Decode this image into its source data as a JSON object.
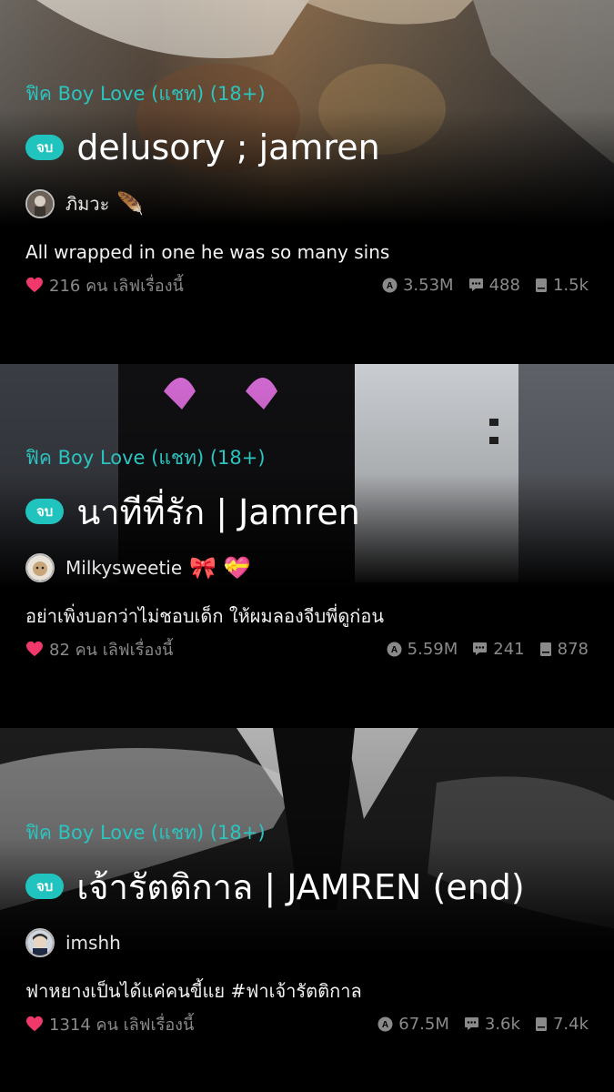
{
  "stories": [
    {
      "category": "ฟิค Boy Love (แชท) (18+)",
      "status_badge": "จบ",
      "title": "delusory ; jamren",
      "author": "ภิมวะ",
      "author_emoji": "🪶",
      "description": "All wrapped in one he was so many sins",
      "likes": "216 คน เลิฟเรื่องนี้",
      "views": "3.53M",
      "comments": "488",
      "chapters": "1.5k"
    },
    {
      "category": "ฟิค Boy Love (แชท) (18+)",
      "status_badge": "จบ",
      "title": "นาทีที่รัก | Jamren",
      "author": "Milkysweetie",
      "author_emoji": "🎀 💝",
      "description": "อย่าเพิ่งบอกว่าไม่ชอบเด็ก ให้ผมลองจีบพี่ดูก่อน",
      "likes": "82 คน เลิฟเรื่องนี้",
      "views": "5.59M",
      "comments": "241",
      "chapters": "878"
    },
    {
      "category": "ฟิค Boy Love (แชท) (18+)",
      "status_badge": "จบ",
      "title": "เจ้ารัตติกาล | JAMREN (end)",
      "author": "imshh",
      "author_emoji": "",
      "description": "ฟาหยางเป็นได้แค่คนขี้แย  #ฟาเจ้ารัตติกาล",
      "likes": "1314 คน เลิฟเรื่องนี้",
      "views": "67.5M",
      "comments": "3.6k",
      "chapters": "7.4k"
    }
  ],
  "colors": {
    "accent": "#20c3be",
    "heart": "#f0386b",
    "muted": "#8a8a8a"
  }
}
